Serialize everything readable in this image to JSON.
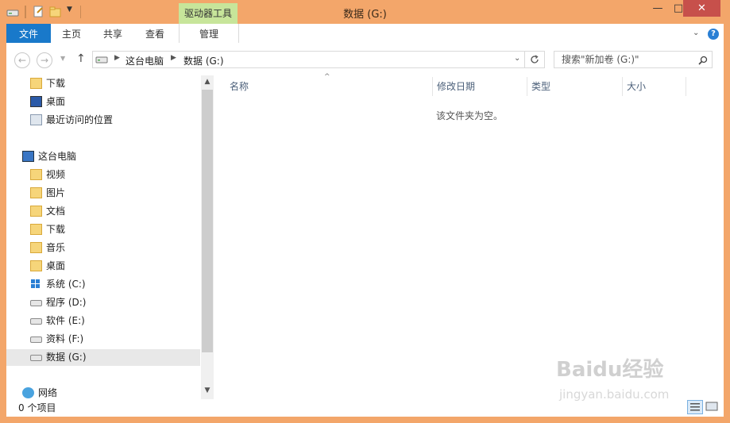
{
  "window": {
    "title": "数据 (G:)",
    "context_tab": "驱动器工具",
    "controls": {
      "minimize": "—",
      "maximize": "□",
      "close": "✕"
    }
  },
  "ribbon": {
    "tabs": [
      "文件",
      "主页",
      "共享",
      "查看",
      "管理"
    ],
    "help_icon": "?"
  },
  "address": {
    "breadcrumb": [
      "这台电脑",
      "数据 (G:)"
    ],
    "search_placeholder": "搜索\"新加卷 (G:)\""
  },
  "nav": {
    "quick_access": [
      {
        "label": "下载",
        "icon": "download-folder-icon"
      },
      {
        "label": "桌面",
        "icon": "desktop-icon"
      },
      {
        "label": "最近访问的位置",
        "icon": "recent-places-icon"
      }
    ],
    "this_pc": {
      "label": "这台电脑",
      "icon": "computer-icon"
    },
    "pc_items": [
      {
        "label": "视频",
        "icon": "videos-folder-icon"
      },
      {
        "label": "图片",
        "icon": "pictures-folder-icon"
      },
      {
        "label": "文档",
        "icon": "documents-folder-icon"
      },
      {
        "label": "下载",
        "icon": "download-folder-icon"
      },
      {
        "label": "音乐",
        "icon": "music-folder-icon"
      },
      {
        "label": "桌面",
        "icon": "desktop-folder-icon"
      },
      {
        "label": "系统 (C:)",
        "icon": "windows-drive-icon"
      },
      {
        "label": "程序 (D:)",
        "icon": "drive-icon"
      },
      {
        "label": "软件 (E:)",
        "icon": "drive-icon"
      },
      {
        "label": "资料 (F:)",
        "icon": "drive-icon"
      },
      {
        "label": "数据 (G:)",
        "icon": "drive-icon",
        "selected": true
      }
    ],
    "network": {
      "label": "网络",
      "icon": "network-icon"
    }
  },
  "file_list": {
    "columns": [
      "名称",
      "修改日期",
      "类型",
      "大小"
    ],
    "sort_indicator": "^",
    "empty_message": "该文件夹为空。"
  },
  "status": {
    "item_count": "0 个项目"
  },
  "watermark": {
    "logo_text": "Baidu经验",
    "url": "jingyan.baidu.com"
  },
  "colors": {
    "frame": "#f3a66a",
    "file_tab": "#1979ca",
    "context_tab": "#c7e59a",
    "close_button": "#c7504b"
  }
}
